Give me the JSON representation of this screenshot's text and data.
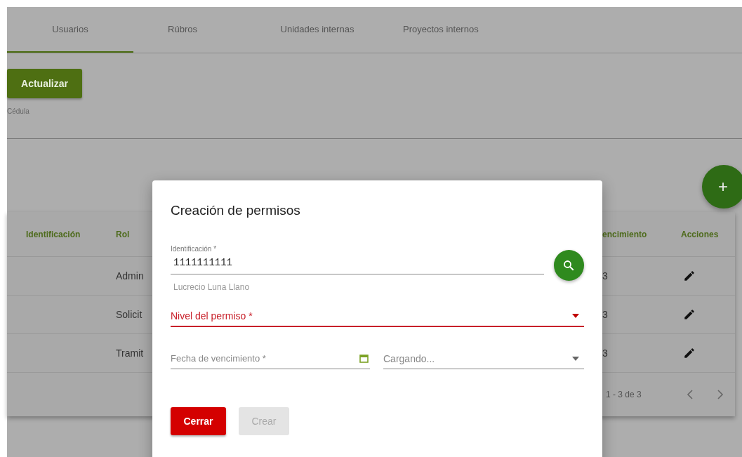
{
  "tabs": [
    {
      "label": "Usuarios",
      "selected": true
    },
    {
      "label": "Rúbros",
      "selected": false
    },
    {
      "label": "Unidades internas",
      "selected": false
    },
    {
      "label": "Proyectos internos",
      "selected": false
    }
  ],
  "refresh_button": "Actualizar",
  "cedula_label": "Cédula",
  "add_button": "+",
  "table": {
    "columns": [
      "Identificación",
      "Rol",
      "encimiento",
      "Acciones"
    ],
    "rows": [
      {
        "rol": "Admin",
        "date": "3"
      },
      {
        "rol": "Solicit",
        "date": "3"
      },
      {
        "rol": "Tramit",
        "date": "3"
      }
    ],
    "pagination": "1 - 3 de 3"
  },
  "dialog": {
    "title": "Creación de permisos",
    "identificacion": {
      "label": "Identificación *",
      "value": "1111111111",
      "hint": "Lucrecio Luna Llano"
    },
    "nivel": {
      "placeholder": "Nivel del permiso *",
      "error": true
    },
    "fecha": {
      "placeholder": "Fecha de vencimiento *"
    },
    "select": {
      "placeholder": "Cargando..."
    },
    "buttons": [
      {
        "label": "Cerrar",
        "kind": "danger",
        "disabled": false
      },
      {
        "label": "Crear",
        "kind": "primary",
        "disabled": true
      }
    ]
  }
}
